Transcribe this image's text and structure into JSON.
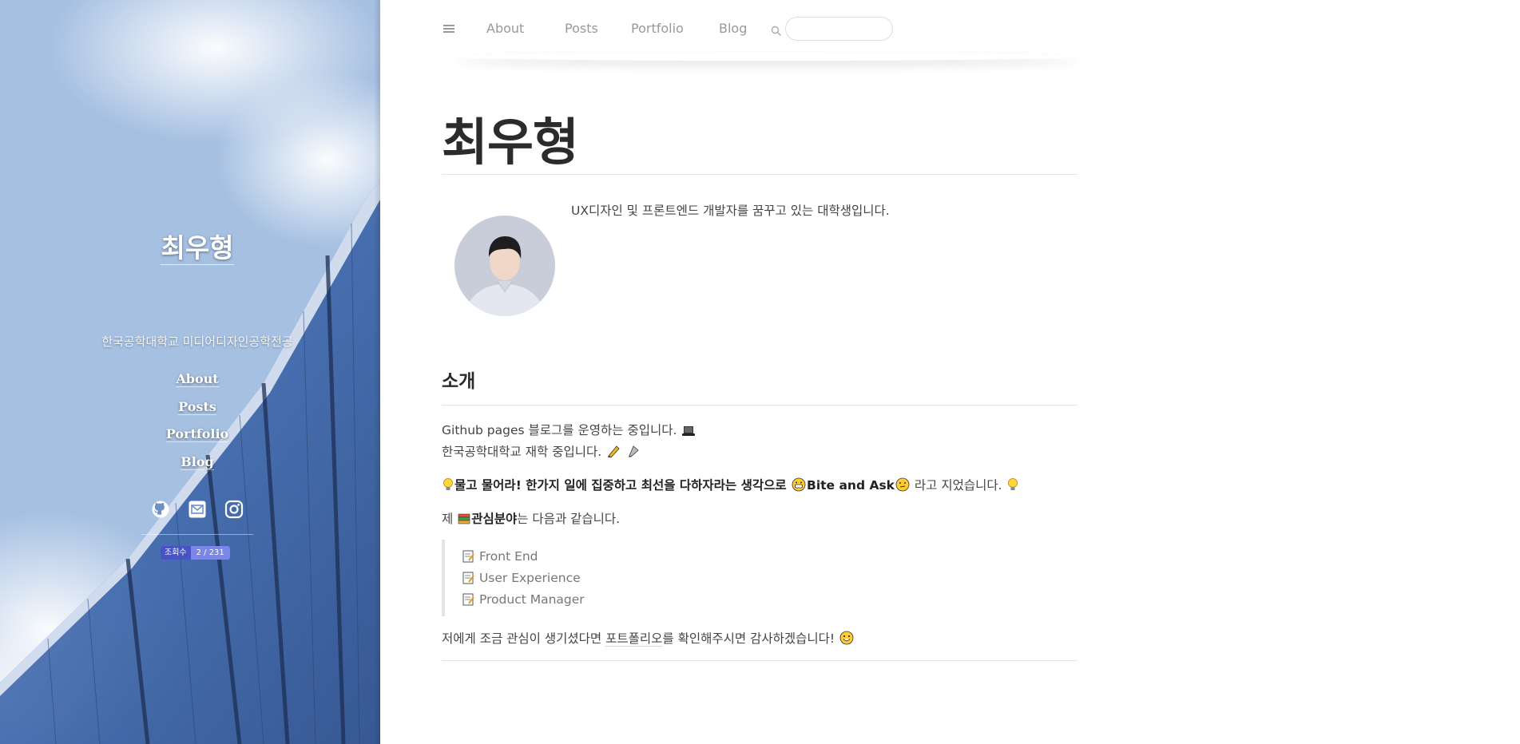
{
  "sidebar": {
    "title": "최우형",
    "subtitle": "한국공학대학교 미디어디자인공학전공",
    "nav": [
      "About",
      "Posts",
      "Portfolio",
      "Blog"
    ],
    "social_icons": [
      "github-icon",
      "mail-icon",
      "instagram-icon"
    ],
    "hits": {
      "label": "조회수",
      "value": "2 / 231"
    }
  },
  "topnav": {
    "menu_icon": "hamburger-icon",
    "links": [
      "About",
      "Posts",
      "Portfolio",
      "Blog"
    ],
    "search_icon": "search-icon",
    "search_placeholder": ""
  },
  "main": {
    "title": "최우형",
    "intro": "UX디자인 및 프론트엔드 개발자를 꿈꾸고 있는 대학생입니다.",
    "section_heading": "소개",
    "line1": "Github pages 블로그를 운영하는 중입니다.",
    "line2": "한국공학대학교 재학 중입니다.",
    "motto_pre": "물고 물어라! 한가지 일에 집중하고 최선을 다하자라는 생각으로 ",
    "motto_bold": "Bite and Ask",
    "motto_post": " 라고 지었습니다.",
    "interest_pre": "제 ",
    "interest_bold": "관심분야",
    "interest_post": "는 다음과 같습니다.",
    "interests": [
      "Front End",
      "User Experience",
      "Product Manager"
    ],
    "closing_pre": "저에게 조금 관심이 생기셨다면 ",
    "closing_link": "포트폴리오",
    "closing_post": "를 확인해주시면 감사하겠습니다!"
  },
  "colors": {
    "hits_label_bg": "#4853c4",
    "hits_value_bg": "#7a86e8",
    "nav_text": "#999999",
    "body_text": "#444444"
  }
}
